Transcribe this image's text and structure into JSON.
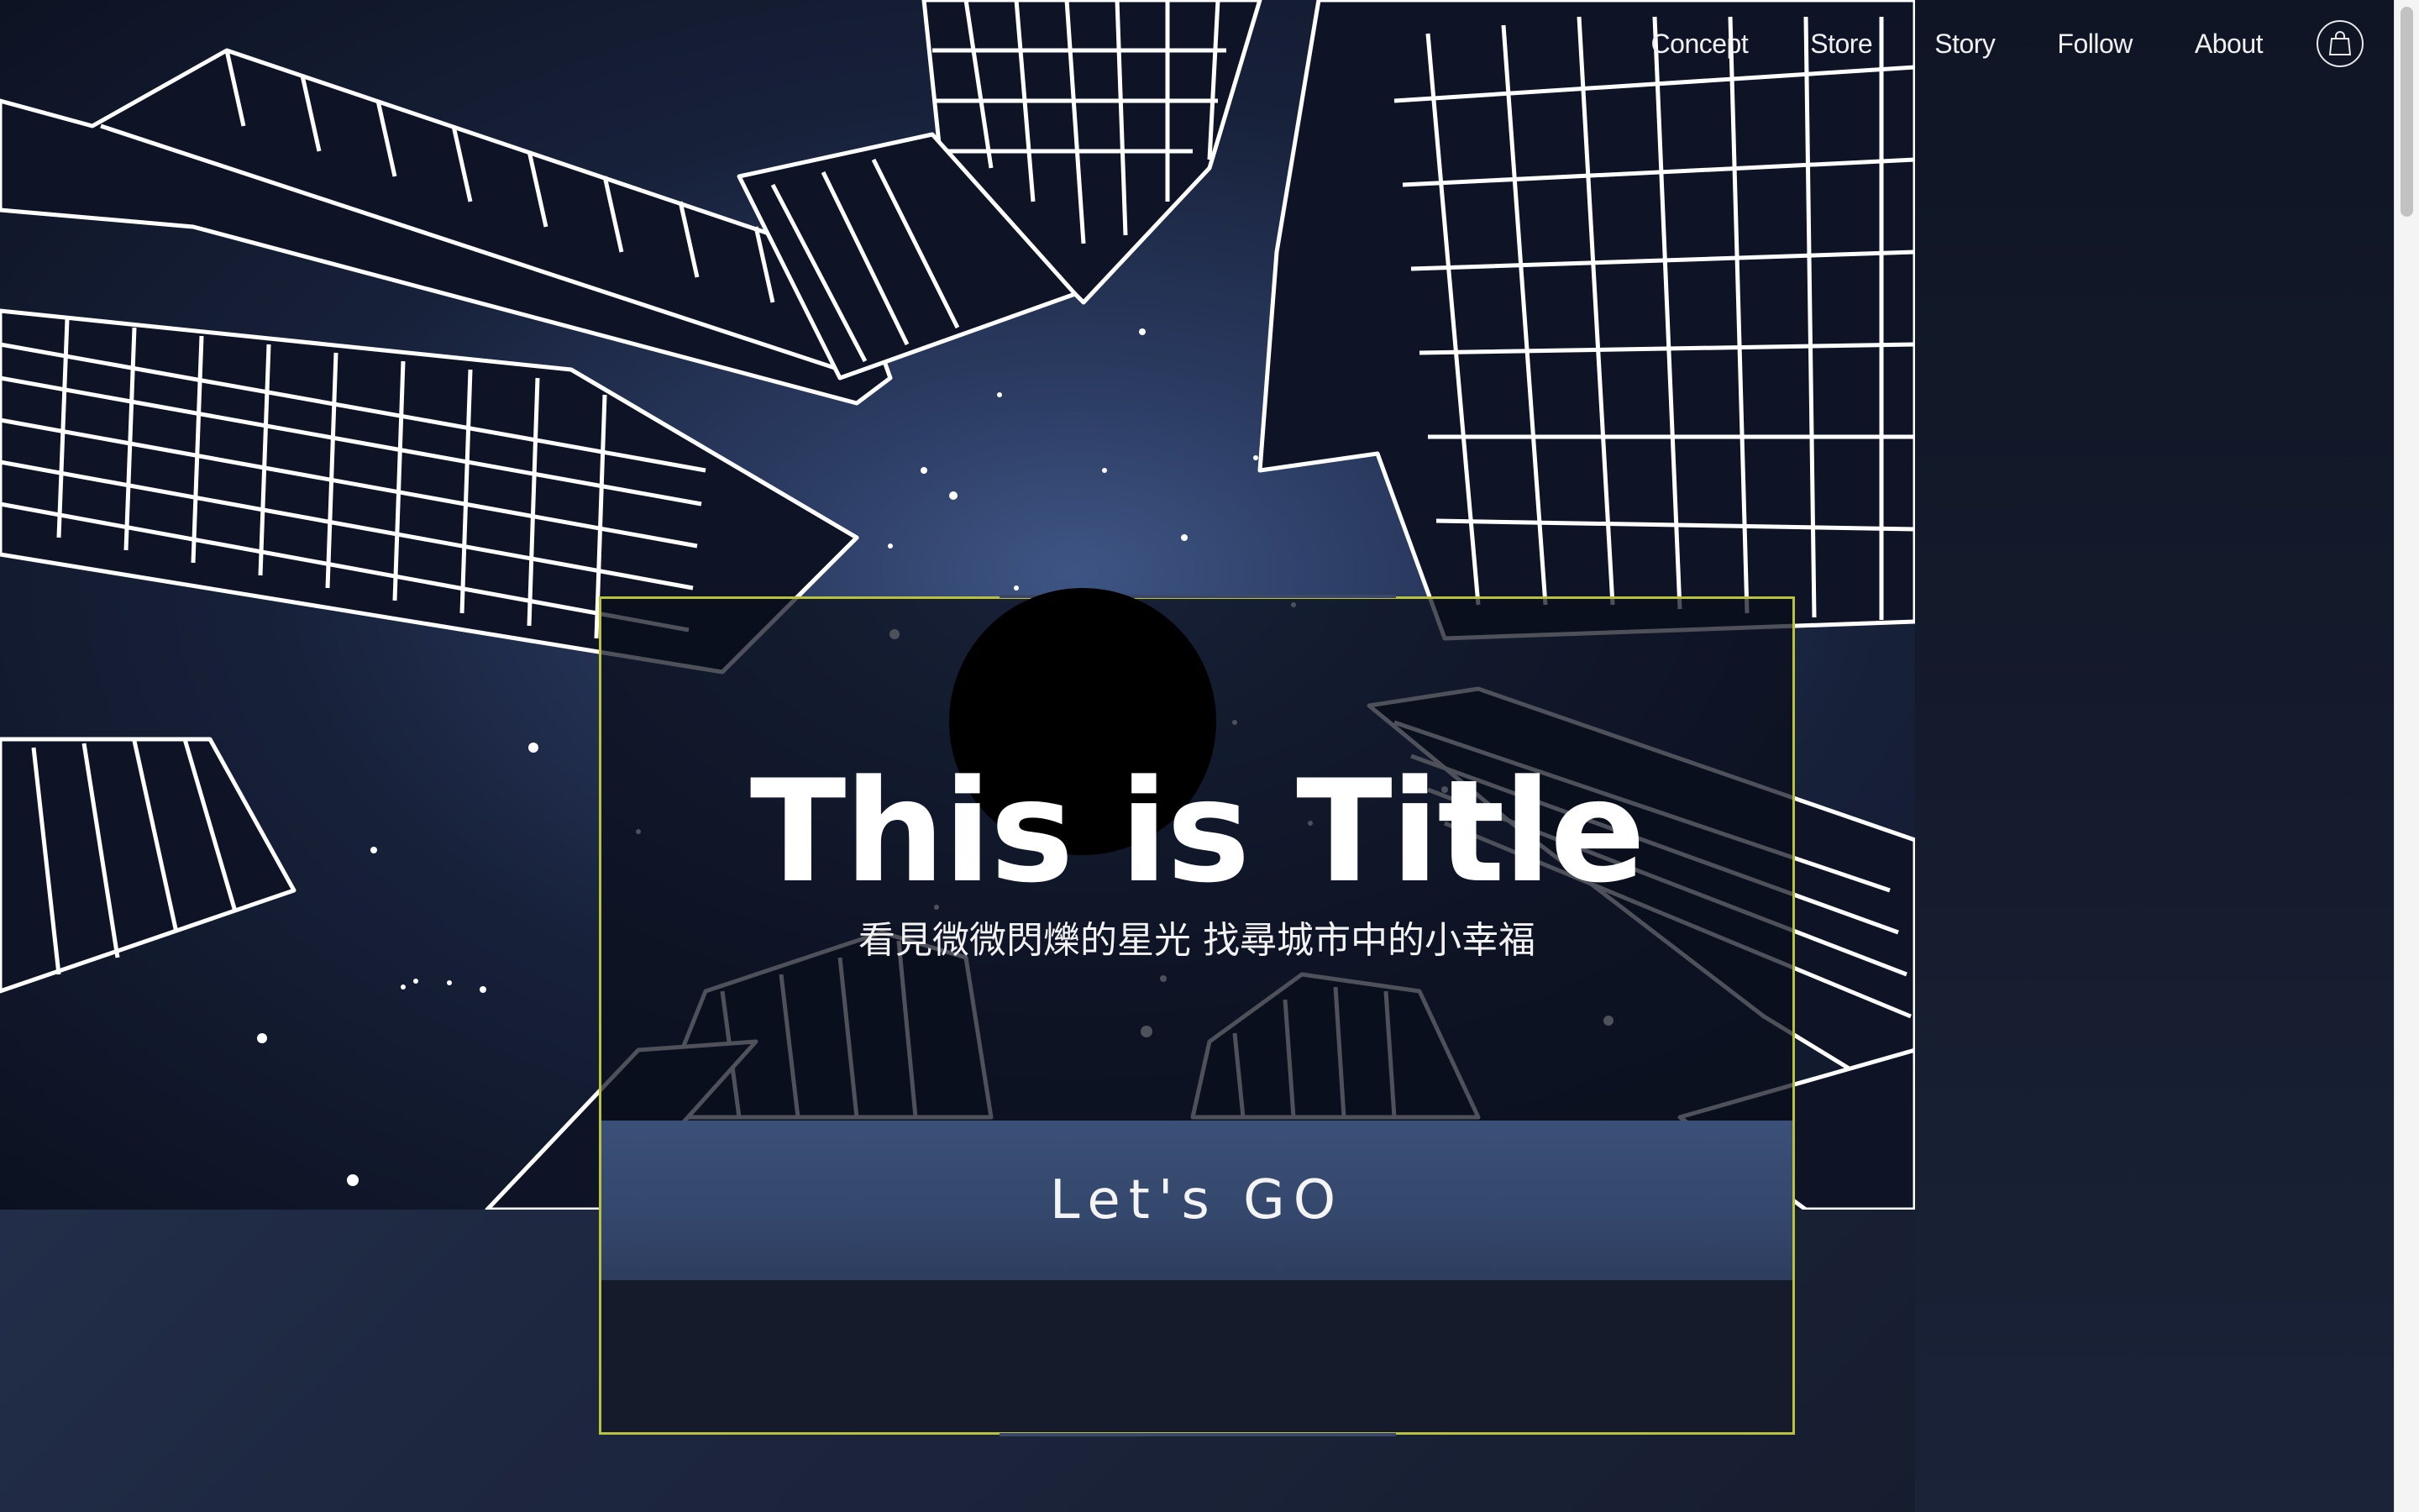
{
  "nav": {
    "items": [
      "Concept",
      "Store",
      "Story",
      "Follow",
      "About"
    ],
    "cart_icon": "shopping-bag-icon"
  },
  "hero": {
    "title": "This is Title",
    "subtitle": "看見微微閃爍的星光 找尋城市中的小幸福",
    "cta_label": "Let's GO"
  },
  "colors": {
    "frame_border": "#b9c23a",
    "cta_background": "#34476c",
    "hero_sky": "#17213a"
  }
}
